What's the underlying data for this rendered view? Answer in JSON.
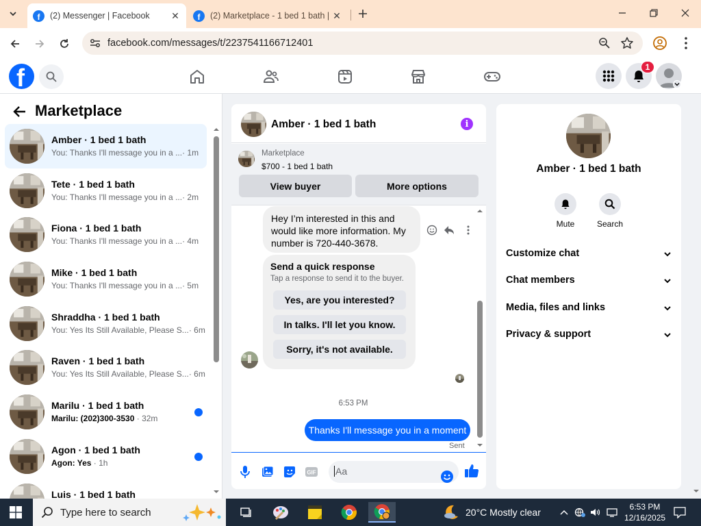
{
  "browser": {
    "tabs": [
      {
        "title": "(2) Messenger | Facebook",
        "active": true
      },
      {
        "title": "(2) Marketplace - 1 bed 1 bath |",
        "active": false
      }
    ],
    "url": "facebook.com/messages/t/2237541166712401"
  },
  "fb": {
    "notification_count": "1",
    "brand_color": "#0866ff"
  },
  "left_panel": {
    "title": "Marketplace",
    "conversations": [
      {
        "name": "Amber · 1 bed 1 bath",
        "preview": "You: Thanks I'll message you in a ...",
        "ago": "· 1m",
        "selected": true,
        "unread": false
      },
      {
        "name": "Tete · 1 bed 1 bath",
        "preview": "You: Thanks I'll message you in a ...",
        "ago": "· 2m",
        "selected": false,
        "unread": false
      },
      {
        "name": "Fiona · 1 bed 1 bath",
        "preview": "You: Thanks I'll message you in a ...",
        "ago": "· 4m",
        "selected": false,
        "unread": false
      },
      {
        "name": "Mike · 1 bed 1 bath",
        "preview": "You: Thanks I'll message you in a ...",
        "ago": "· 5m",
        "selected": false,
        "unread": false
      },
      {
        "name": "Shraddha · 1 bed 1 bath",
        "preview": "You: Yes Its Still Available, Please S...",
        "ago": "· 6m",
        "selected": false,
        "unread": false
      },
      {
        "name": "Raven · 1 bed 1 bath",
        "preview": "You: Yes Its Still Available, Please S...",
        "ago": "· 6m",
        "selected": false,
        "unread": false
      },
      {
        "name": "Marilu · 1 bed 1 bath",
        "preview": "Marilu: (202)300-3530",
        "ago": " · 32m",
        "selected": false,
        "unread": true
      },
      {
        "name": "Agon · 1 bed 1 bath",
        "preview": "Agon: Yes",
        "ago": " · 1h",
        "selected": false,
        "unread": true
      },
      {
        "name": "Luis · 1 bed 1 bath",
        "preview": "",
        "ago": "",
        "selected": false,
        "unread": false
      }
    ]
  },
  "chat": {
    "title": "Amber · 1 bed 1 bath",
    "listing_category": "Marketplace",
    "listing_price": "$700 - 1 bed 1 bath",
    "view_buyer_label": "View buyer",
    "more_options_label": "More options",
    "incoming_message": "Hey I’m interested in this and would like more information. My number is 720-440-3678.",
    "quick_response_title": "Send a quick response",
    "quick_response_subtitle": "Tap a response to send it to the buyer.",
    "quick_responses": [
      "Yes, are you interested?",
      "In talks. I'll let you know.",
      "Sorry, it's not available."
    ],
    "timestamp": "6:53 PM",
    "outgoing_message": "Thanks I'll message you in a moment",
    "outgoing_status": "Sent",
    "composer_placeholder": "Aa"
  },
  "right_panel": {
    "title": "Amber · 1 bed 1 bath",
    "actions": [
      {
        "label": "Mute",
        "icon": "bell-icon"
      },
      {
        "label": "Search",
        "icon": "search-icon"
      }
    ],
    "sections": [
      "Customize chat",
      "Chat members",
      "Media, files and links",
      "Privacy & support"
    ]
  },
  "taskbar": {
    "search_placeholder": "Type here to search",
    "weather": "20°C  Mostly clear",
    "time": "6:53 PM",
    "date": "12/16/2025"
  }
}
